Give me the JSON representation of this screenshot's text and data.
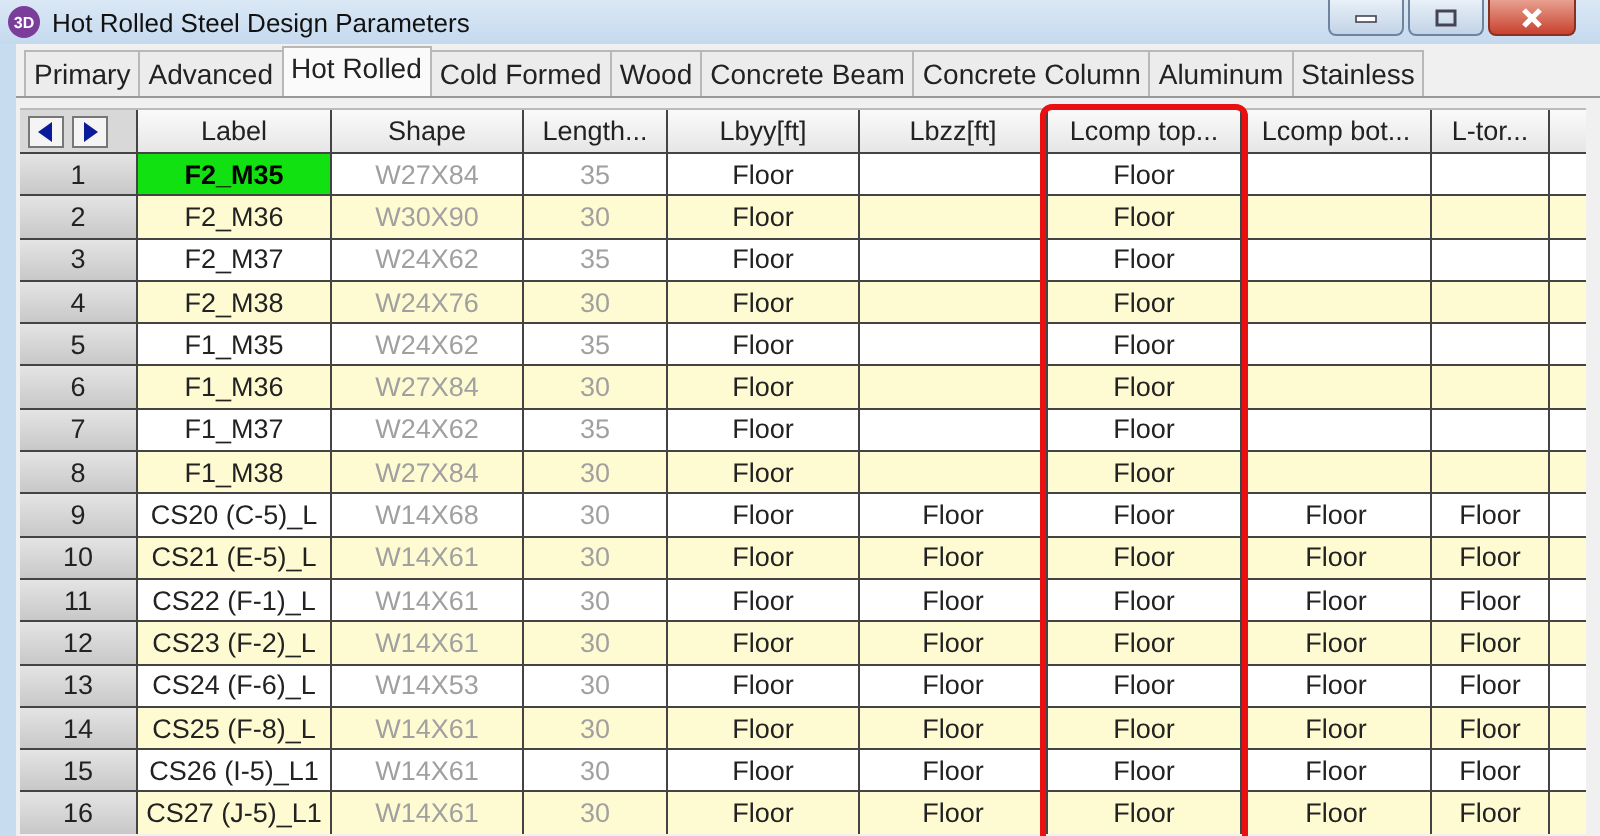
{
  "window": {
    "app_icon": "3D",
    "title": "Hot Rolled Steel Design Parameters"
  },
  "tabs": [
    {
      "label": "Primary",
      "selected": false
    },
    {
      "label": "Advanced",
      "selected": false
    },
    {
      "label": "Hot Rolled",
      "selected": true
    },
    {
      "label": "Cold Formed",
      "selected": false
    },
    {
      "label": "Wood",
      "selected": false
    },
    {
      "label": "Concrete Beam",
      "selected": false
    },
    {
      "label": "Concrete Column",
      "selected": false
    },
    {
      "label": "Aluminum",
      "selected": false
    },
    {
      "label": "Stainless",
      "selected": false
    }
  ],
  "table": {
    "columns": [
      {
        "label": "Label",
        "disabled": false,
        "highlighted": false
      },
      {
        "label": "Shape",
        "disabled": true,
        "highlighted": false
      },
      {
        "label": "Length...",
        "disabled": true,
        "highlighted": false
      },
      {
        "label": "Lbyy[ft]",
        "disabled": false,
        "highlighted": false
      },
      {
        "label": "Lbzz[ft]",
        "disabled": false,
        "highlighted": false
      },
      {
        "label": "Lcomp top...",
        "disabled": false,
        "highlighted": true
      },
      {
        "label": "Lcomp bot...",
        "disabled": false,
        "highlighted": false
      },
      {
        "label": "L-tor...",
        "disabled": false,
        "highlighted": false
      }
    ],
    "rows": [
      {
        "number": "1",
        "selected": true,
        "cells": [
          "F2_M35",
          "W27X84",
          "35",
          "Floor",
          null,
          "Floor",
          null,
          null
        ]
      },
      {
        "number": "2",
        "selected": false,
        "cells": [
          "F2_M36",
          "W30X90",
          "30",
          "Floor",
          null,
          "Floor",
          null,
          null
        ]
      },
      {
        "number": "3",
        "selected": false,
        "cells": [
          "F2_M37",
          "W24X62",
          "35",
          "Floor",
          null,
          "Floor",
          null,
          null
        ]
      },
      {
        "number": "4",
        "selected": false,
        "cells": [
          "F2_M38",
          "W24X76",
          "30",
          "Floor",
          null,
          "Floor",
          null,
          null
        ]
      },
      {
        "number": "5",
        "selected": false,
        "cells": [
          "F1_M35",
          "W24X62",
          "35",
          "Floor",
          null,
          "Floor",
          null,
          null
        ]
      },
      {
        "number": "6",
        "selected": false,
        "cells": [
          "F1_M36",
          "W27X84",
          "30",
          "Floor",
          null,
          "Floor",
          null,
          null
        ]
      },
      {
        "number": "7",
        "selected": false,
        "cells": [
          "F1_M37",
          "W24X62",
          "35",
          "Floor",
          null,
          "Floor",
          null,
          null
        ]
      },
      {
        "number": "8",
        "selected": false,
        "cells": [
          "F1_M38",
          "W27X84",
          "30",
          "Floor",
          null,
          "Floor",
          null,
          null
        ]
      },
      {
        "number": "9",
        "selected": false,
        "cells": [
          "CS20 (C-5)_L",
          "W14X68",
          "30",
          "Floor",
          "Floor",
          "Floor",
          "Floor",
          "Floor"
        ]
      },
      {
        "number": "10",
        "selected": false,
        "cells": [
          "CS21 (E-5)_L",
          "W14X61",
          "30",
          "Floor",
          "Floor",
          "Floor",
          "Floor",
          "Floor"
        ]
      },
      {
        "number": "11",
        "selected": false,
        "cells": [
          "CS22 (F-1)_L",
          "W14X61",
          "30",
          "Floor",
          "Floor",
          "Floor",
          "Floor",
          "Floor"
        ]
      },
      {
        "number": "12",
        "selected": false,
        "cells": [
          "CS23 (F-2)_L",
          "W14X61",
          "30",
          "Floor",
          "Floor",
          "Floor",
          "Floor",
          "Floor"
        ]
      },
      {
        "number": "13",
        "selected": false,
        "cells": [
          "CS24 (F-6)_L",
          "W14X53",
          "30",
          "Floor",
          "Floor",
          "Floor",
          "Floor",
          "Floor"
        ]
      },
      {
        "number": "14",
        "selected": false,
        "cells": [
          "CS25 (F-8)_L",
          "W14X61",
          "30",
          "Floor",
          "Floor",
          "Floor",
          "Floor",
          "Floor"
        ]
      },
      {
        "number": "15",
        "selected": false,
        "cells": [
          "CS26 (I-5)_L1",
          "W14X61",
          "30",
          "Floor",
          "Floor",
          "Floor",
          "Floor",
          "Floor"
        ]
      },
      {
        "number": "16",
        "selected": false,
        "cells": [
          "CS27 (J-5)_L1",
          "W14X61",
          "30",
          "Floor",
          "Floor",
          "Floor",
          "Floor",
          "Floor"
        ]
      }
    ]
  }
}
